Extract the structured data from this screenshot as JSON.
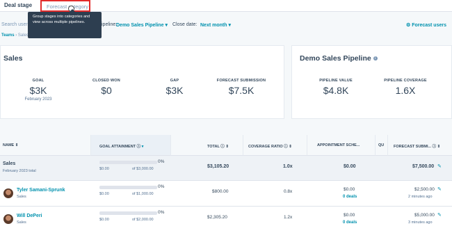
{
  "tabs": {
    "deal_stage": "Deal stage",
    "forecast_category": "Forecast category"
  },
  "tooltip": {
    "text": "Group stages into categories and view across multiple pipelines."
  },
  "filters": {
    "search_placeholder": "Search users",
    "pipeline_label": "ipeline:",
    "pipeline_value": "Demo Sales Pipeline",
    "close_date_label": "Close date:",
    "close_date_value": "Next month",
    "forecast_users": "Forecast users"
  },
  "breadcrumb": {
    "root": "Teams",
    "current": "Sales"
  },
  "sales_card": {
    "title": "Sales",
    "metrics": [
      {
        "label": "GOAL",
        "value": "$3K",
        "sub": "February 2023"
      },
      {
        "label": "CLOSED WON",
        "value": "$0",
        "sub": ""
      },
      {
        "label": "GAP",
        "value": "$3K",
        "sub": ""
      },
      {
        "label": "FORECAST SUBMISSION",
        "value": "$7.5K",
        "sub": ""
      }
    ]
  },
  "pipeline_card": {
    "title": "Demo Sales Pipeline",
    "metrics": [
      {
        "label": "PIPELINE VALUE",
        "value": "$4.8K"
      },
      {
        "label": "PIPELINE COVERAGE",
        "value": "1.6X"
      }
    ]
  },
  "table": {
    "headers": [
      "NAME",
      "GOAL ATTAINMENT",
      "TOTAL",
      "COVERAGE RATIO",
      "APPOINTMENT SCHE...",
      "QU",
      "FORECAST SUBMI..."
    ],
    "rows": [
      {
        "name": "Sales",
        "sub": "February 2023 total",
        "pct": "0%",
        "closed": "$0.00",
        "goal": "of $3,000.00",
        "attainment": 0,
        "total": "$3,105.20",
        "ratio": "1.0x",
        "appt": "$0.00",
        "deals": "",
        "forecast": "$7,500.00",
        "time": ""
      },
      {
        "name": "Tyler Samani-Sprunk",
        "sub": "Sales",
        "pct": "0%",
        "closed": "$0.00",
        "goal": "of $1,000.00",
        "attainment": 0,
        "total": "$800.00",
        "ratio": "0.8x",
        "appt": "$0.00",
        "deals": "0 deals",
        "forecast": "$2,500.00",
        "time": "2 minutes ago"
      },
      {
        "name": "Will DePeri",
        "sub": "Sales",
        "pct": "0%",
        "closed": "$0.00",
        "goal": "of $2,000.00",
        "attainment": 0,
        "total": "$2,305.20",
        "ratio": "1.2x",
        "appt": "$0.00",
        "deals": "0 deals",
        "forecast": "$5,000.00",
        "time": "3 minutes ago"
      }
    ]
  },
  "colors": {
    "accent": "#0091ae",
    "highlight": "#e22b2b",
    "tooltip_bg": "#2d3e50"
  }
}
